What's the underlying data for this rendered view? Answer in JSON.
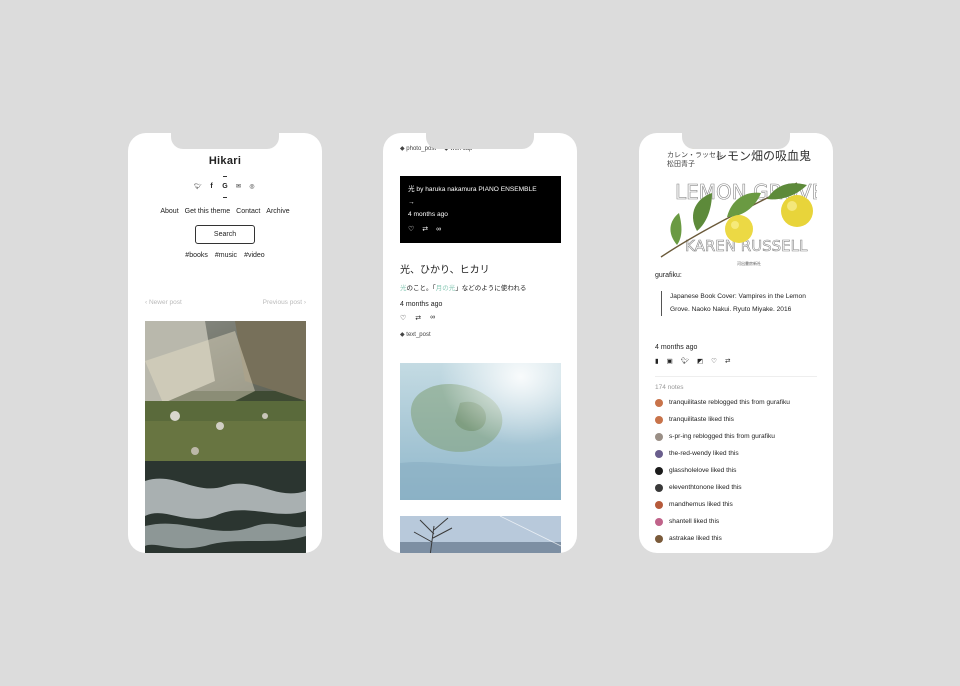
{
  "colors": {
    "background": "#dcdcdc",
    "accent": "#8ac9b6"
  },
  "phone1": {
    "blog_title": "Hikari",
    "social_icons": [
      "twitter-icon",
      "facebook-icon",
      "google-icon",
      "mail-icon",
      "instagram-icon"
    ],
    "nav": [
      "About",
      "Get this theme",
      "Contact",
      "Archive"
    ],
    "search_label": "Search",
    "tags": [
      "#books",
      "#music",
      "#video"
    ],
    "newer": "‹ Newer post",
    "previous": "Previous post ›"
  },
  "phone2": {
    "tags_top": [
      "photo_post",
      "with cap"
    ],
    "audio_title": "光 by haruka nakamura PIANO ENSEMBLE",
    "audio_arrow": "→",
    "audio_time": "4 months ago",
    "text_title": "光、ひかり、ヒカリ",
    "body_pre": "光",
    "body_mid": "のこと。「",
    "body_link": "月の光",
    "body_post": "」などのように使われる",
    "time": "4 months ago",
    "tag": "text_post"
  },
  "phone3": {
    "cover": {
      "top_jp": "カレン・ラッセル",
      "author_jp": "松田青子",
      "title_jp": "レモン畑の吸血鬼",
      "l1": "LEMON GROVE",
      "l2": "KAREN RUSSELL",
      "publisher": "河出書房新社"
    },
    "source": "gurafiku:",
    "quote": "Japanese Book Cover: Vampires in the Lemon Grove. Naoko Nakui. Ryuto Miyake. 2016",
    "time": "4 months ago",
    "notes_count": "174 notes",
    "notes": [
      {
        "text": "tranquilitaste reblogged this from gurafiku",
        "color": "#c8734a"
      },
      {
        "text": "tranquilitaste liked this",
        "color": "#c8734a"
      },
      {
        "text": "s-pr-ing reblogged this from gurafiku",
        "color": "#9a8f86"
      },
      {
        "text": "the-red-wendy liked this",
        "color": "#6a5e8d"
      },
      {
        "text": "glassholelove liked this",
        "color": "#1b1b1b"
      },
      {
        "text": "eleventhtonone liked this",
        "color": "#3a3a3a"
      },
      {
        "text": "mandhemus liked this",
        "color": "#b65a3a"
      },
      {
        "text": "shantell liked this",
        "color": "#c0638a"
      },
      {
        "text": "astrakae liked this",
        "color": "#7a5a3a"
      }
    ]
  }
}
